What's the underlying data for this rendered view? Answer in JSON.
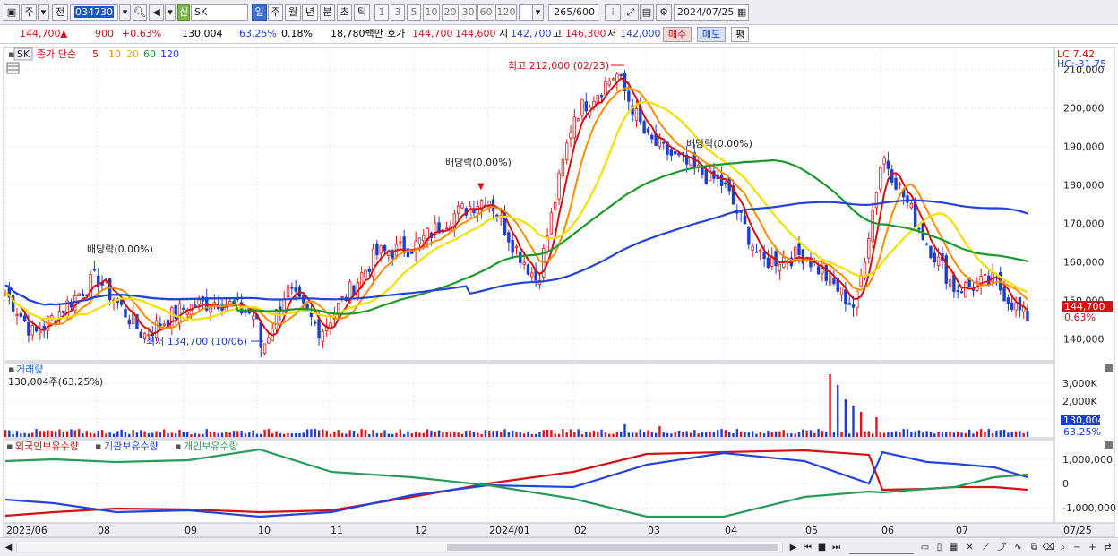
{
  "toolbar": {
    "period_button": "주",
    "prev_button": "전",
    "stock_code": "034730",
    "market_badge": "신",
    "stock_name": "SK",
    "period_tabs": [
      "일",
      "주",
      "월",
      "년",
      "분",
      "초",
      "틱"
    ],
    "interval_options": [
      "1",
      "3",
      "5",
      "10",
      "20",
      "30",
      "60",
      "120"
    ],
    "count_display": "265",
    "count_max": "/600",
    "date": "2024/07/25"
  },
  "quote": {
    "price": "144,700",
    "change_arrow": "▲",
    "change": "900",
    "change_pct": "+0.63%",
    "volume": "130,004",
    "volume_ratio": "63.25%",
    "turnover_pct": "0.18%",
    "trade_value": "18,780백만",
    "bid_ask_label": "호가",
    "ask": "144,700",
    "bid": "144,600",
    "open_label": "시",
    "open": "142,700",
    "high_label": "고",
    "high": "146,300",
    "low_label": "저",
    "low": "142,000",
    "buy_button": "매수",
    "sell_button": "매도",
    "eval_button": "평"
  },
  "price_panel": {
    "symbol": "SK",
    "ma_label": "종가 단순",
    "ma_periods": [
      "5",
      "10",
      "20",
      "60",
      "120"
    ],
    "ma_colors": [
      "#d41212",
      "#ff8c00",
      "#f0e000",
      "#1a9a28",
      "#2244dd"
    ],
    "lc_label": "LC:7.42",
    "hc_label": "HC:-31.75",
    "annotations": {
      "high": "최고 212,000 (02/23)",
      "low": "최저 134,700 (10/06)",
      "div1": "배당락(0.00%)",
      "div2": "배당락(0.00%)",
      "div3": "배당락(0.00%)"
    },
    "current_price_tag": "144,700",
    "current_pct_tag": "0.63%"
  },
  "volume_panel": {
    "title": "거래량",
    "value": "130,004주(63.25%)",
    "current_tag": "130,004",
    "current_pct": "63.25%"
  },
  "holding_panel": {
    "legend": [
      "외국인보유수량",
      "기관보유수량",
      "개인보유수량"
    ]
  },
  "chart_data": [
    {
      "type": "candlestick",
      "title": "SK",
      "x": [
        "2023/06",
        "08",
        "09",
        "10",
        "11",
        "12",
        "2024/01",
        "02",
        "03",
        "04",
        "05",
        "06",
        "07",
        "07/25"
      ],
      "ylim": [
        135000,
        215000
      ],
      "y_ticks": [
        "140,000",
        "150,000",
        "160,000",
        "170,000",
        "180,000",
        "190,000",
        "200,000",
        "210,000"
      ],
      "close_path": [
        {
          "x": "2023/06",
          "y": 152000
        },
        {
          "x": "2023/06 end",
          "y": 141000
        },
        {
          "x": "07",
          "y": 149000
        },
        {
          "x": "08",
          "y": 156000
        },
        {
          "x": "08 mid",
          "y": 141000
        },
        {
          "x": "09",
          "y": 148000
        },
        {
          "x": "09 mid",
          "y": 150000
        },
        {
          "x": "10",
          "y": 146000
        },
        {
          "x": "10/06",
          "y": 137000
        },
        {
          "x": "10 mid",
          "y": 153000
        },
        {
          "x": "11",
          "y": 142000
        },
        {
          "x": "11 mid",
          "y": 162000
        },
        {
          "x": "12",
          "y": 164000
        },
        {
          "x": "12 mid",
          "y": 172000
        },
        {
          "x": "2024/01",
          "y": 177000
        },
        {
          "x": "01 mid",
          "y": 165000
        },
        {
          "x": "01 end",
          "y": 155000
        },
        {
          "x": "02",
          "y": 198000
        },
        {
          "x": "02/23",
          "y": 209000
        },
        {
          "x": "03",
          "y": 192000
        },
        {
          "x": "03 mid",
          "y": 186000
        },
        {
          "x": "04",
          "y": 180000
        },
        {
          "x": "04 mid",
          "y": 160000
        },
        {
          "x": "05",
          "y": 162000
        },
        {
          "x": "05 end",
          "y": 148000
        },
        {
          "x": "06",
          "y": 188000
        },
        {
          "x": "06 mid",
          "y": 165000
        },
        {
          "x": "07",
          "y": 153000
        },
        {
          "x": "07 mid",
          "y": 155000
        },
        {
          "x": "07/25",
          "y": 144700
        }
      ],
      "annotations": [
        "최고 212,000 (02/23)",
        "최저 134,700 (10/06)"
      ]
    },
    {
      "type": "bar",
      "title": "거래량",
      "y_ticks": [
        "1,000K",
        "2,000K",
        "3,000K"
      ],
      "values_note": "spike near 06",
      "peaks": [
        {
          "x": "06",
          "value": 3500000
        }
      ]
    },
    {
      "type": "line",
      "series": [
        {
          "name": "외국인보유수량",
          "color": "#d41212"
        },
        {
          "name": "기관보유수량",
          "color": "#2244dd"
        },
        {
          "name": "개인보유수량",
          "color": "#2a9a5a"
        }
      ],
      "y_ticks": [
        "1,000,000",
        "0",
        "-1,000,000"
      ]
    }
  ]
}
